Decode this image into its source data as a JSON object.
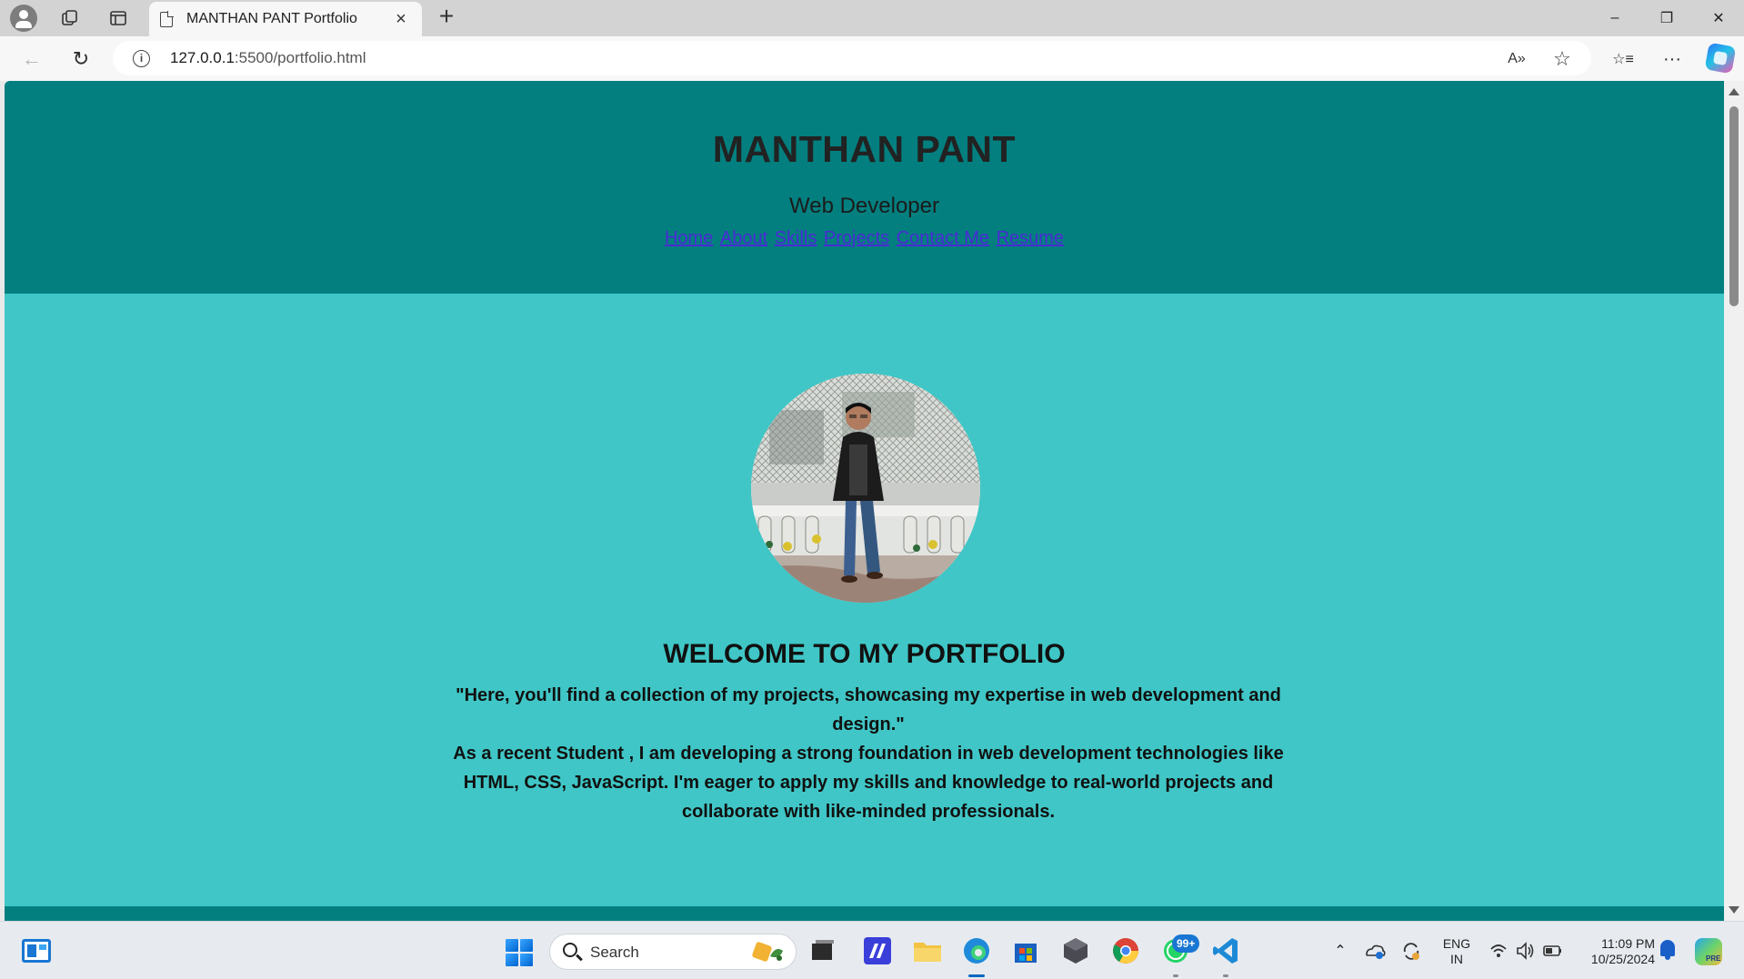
{
  "browser": {
    "tab_title": "MANTHAN PANT Portfolio",
    "tab_close": "×",
    "new_tab": "+",
    "url_host": "127.0.0.1",
    "url_rest": ":5500/portfolio.html",
    "window": {
      "minimize": "–",
      "restore": "❐",
      "close": "✕"
    },
    "nav": {
      "back": "←",
      "reload": "↻"
    },
    "address_icons": {
      "read_aloud": "A»",
      "favorite": "☆",
      "favorites_bar": "☆≡",
      "more": "···"
    }
  },
  "page": {
    "name": "MANTHAN PANT",
    "role": "Web Developer",
    "nav_links": [
      "Home",
      "About",
      "Skills",
      "Projects",
      "Contact Me",
      "Resume"
    ],
    "welcome": "WELCOME TO MY PORTFOLIO",
    "quote": "\"Here, you'll find a collection of my projects, showcasing my expertise in web development and design.\"",
    "intro": "As a recent Student , I am developing a strong foundation in web development technologies like HTML, CSS, JavaScript. I'm eager to apply my skills and knowledge to real-world projects and collaborate with like-minded professionals.",
    "colors": {
      "header": "#037f7f",
      "body": "#40c6c6",
      "link": "#4b2ad6"
    }
  },
  "taskbar": {
    "search_label": "Search",
    "whatsapp_badge": "99+",
    "lang_line1": "ENG",
    "lang_line2": "IN",
    "time": "11:09 PM",
    "date": "10/25/2024",
    "tray_icons": [
      "chevron-up-icon",
      "onedrive-icon",
      "sync-icon",
      "wifi-icon",
      "volume-icon",
      "battery-icon"
    ]
  }
}
